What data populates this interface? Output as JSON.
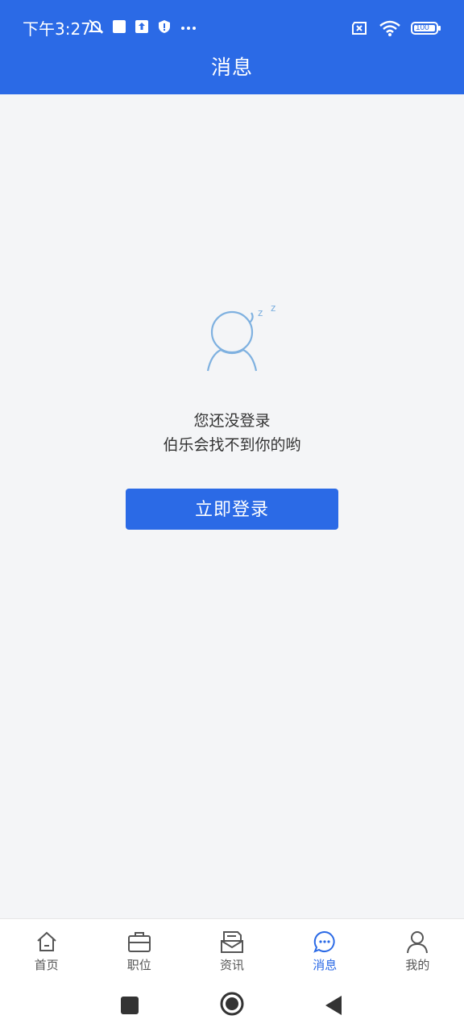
{
  "status_bar": {
    "time": "下午3:27",
    "battery": "100",
    "icons": [
      "mute-bell-icon",
      "square-icon",
      "upload-icon",
      "shield-icon",
      "more-dots-icon",
      "sim-x-icon",
      "wifi-icon",
      "battery-icon"
    ]
  },
  "header": {
    "title": "消息"
  },
  "empty_state": {
    "line1": "您还没登录",
    "line2": "伯乐会找不到你的哟",
    "illustration": "sleeping-person-icon"
  },
  "login_button": {
    "label": "立即登录"
  },
  "tabbar": {
    "tabs": [
      {
        "label": "首页",
        "icon": "home-icon",
        "active": false
      },
      {
        "label": "职位",
        "icon": "briefcase-icon",
        "active": false
      },
      {
        "label": "资讯",
        "icon": "inbox-icon",
        "active": false
      },
      {
        "label": "消息",
        "icon": "chat-bubble-icon",
        "active": true
      },
      {
        "label": "我的",
        "icon": "person-icon",
        "active": false
      }
    ]
  },
  "colors": {
    "brand": "#2b6ae6",
    "background": "#f4f5f7",
    "illustration": "#7fb1e0"
  }
}
